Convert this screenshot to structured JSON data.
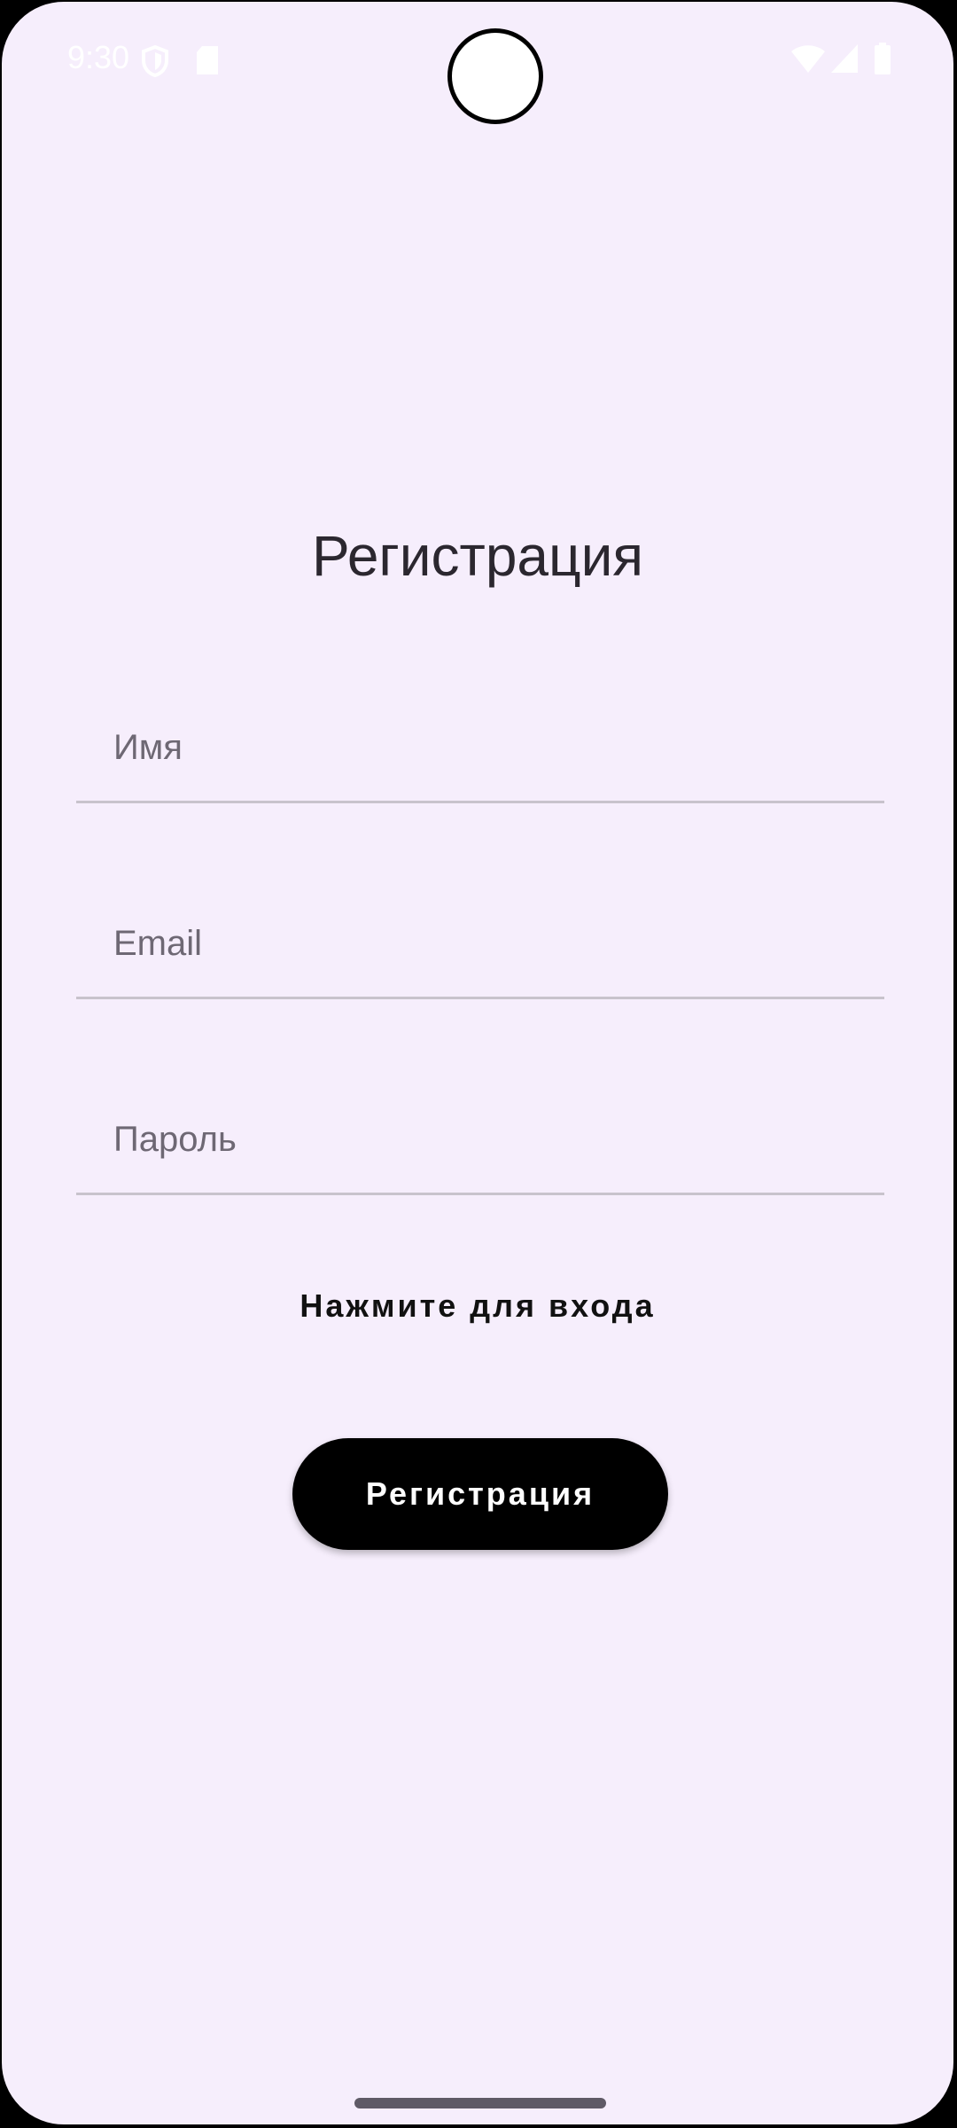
{
  "status_bar": {
    "time": "9:30",
    "icons_left": [
      "shield-icon",
      "sd-card-icon"
    ],
    "icons_right": [
      "wifi-icon",
      "signal-icon",
      "battery-icon"
    ]
  },
  "register": {
    "title": "Регистрация",
    "fields": {
      "name": {
        "value": "",
        "placeholder": "Имя"
      },
      "email": {
        "value": "",
        "placeholder": "Email"
      },
      "password": {
        "value": "",
        "placeholder": "Пароль"
      }
    },
    "login_link": "Нажмите для входа",
    "submit_label": "Регистрация"
  },
  "colors": {
    "background": "#f6eefc",
    "button": "#000000",
    "button_text": "#ffffff",
    "field_underline": "#c8c3cc",
    "placeholder": "#6e6874"
  }
}
